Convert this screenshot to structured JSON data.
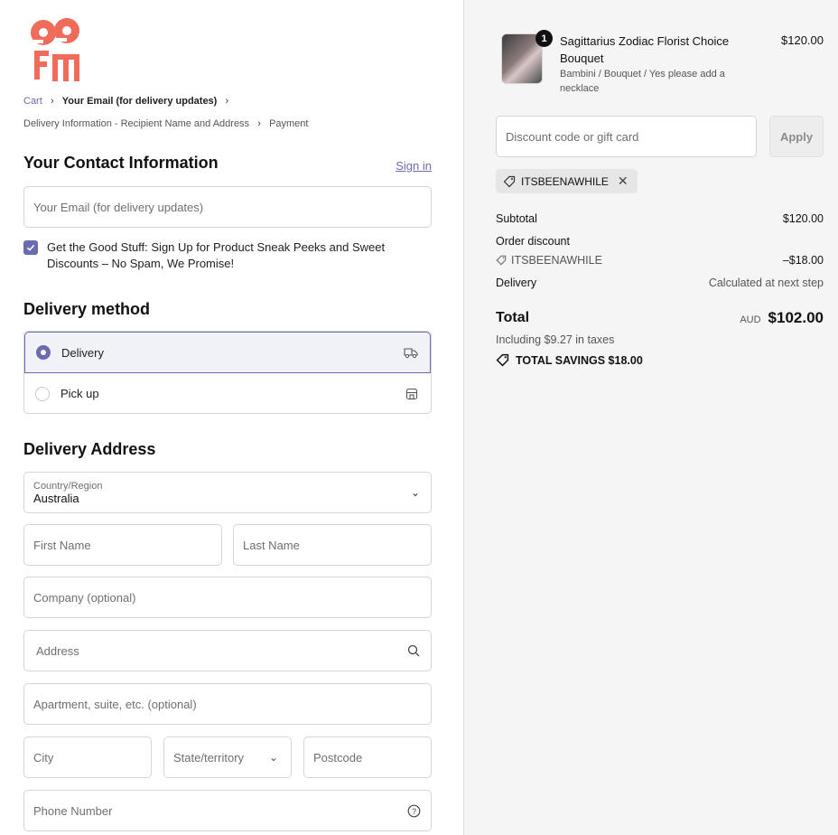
{
  "brand": {
    "logo_text": "ee fm",
    "logo_color": "#f06b5a"
  },
  "breadcrumbs": {
    "row1": [
      "Cart",
      "Your Email (for delivery updates)"
    ],
    "row2": [
      "Delivery Information - Recipient Name and Address",
      "Payment"
    ]
  },
  "contact": {
    "title": "Your Contact Information",
    "signin": "Sign in",
    "email_placeholder": "Your Email (for delivery updates)",
    "newsletter_label": "Get the Good Stuff: Sign Up for Product Sneak Peeks and Sweet Discounts – No Spam, We Promise!",
    "newsletter_checked": true
  },
  "delivery_method": {
    "title": "Delivery method",
    "options": [
      {
        "label": "Delivery",
        "selected": true,
        "icon": "truck-icon"
      },
      {
        "label": "Pick up",
        "selected": false,
        "icon": "store-icon"
      }
    ]
  },
  "delivery_address": {
    "title": "Delivery Address",
    "country_label": "Country/Region",
    "country_value": "Australia",
    "first_name": "First Name",
    "last_name": "Last Name",
    "company": "Company (optional)",
    "address": "Address",
    "apartment": "Apartment, suite, etc. (optional)",
    "city": "City",
    "state": "State/territory",
    "postcode": "Postcode",
    "phone": "Phone Number"
  },
  "summary": {
    "item": {
      "qty": "1",
      "name": "Sagittarius Zodiac Florist Choice Bouquet",
      "variant": "Bambini / Bouquet / Yes please add a necklace",
      "price": "$120.00"
    },
    "discount_placeholder": "Discount code or gift card",
    "apply": "Apply",
    "applied_code": "ITSBEENAWHILE",
    "subtotal_label": "Subtotal",
    "subtotal_value": "$120.00",
    "order_discount_label": "Order discount",
    "discount_code": "ITSBEENAWHILE",
    "discount_value": "–$18.00",
    "delivery_label": "Delivery",
    "delivery_value": "Calculated at next step",
    "total_label": "Total",
    "currency": "AUD",
    "total_value": "$102.00",
    "taxes": "Including $9.27 in taxes",
    "savings": "TOTAL SAVINGS  $18.00"
  },
  "colors": {
    "accent": "#6b6bb0",
    "panel": "#f5f5f5"
  }
}
